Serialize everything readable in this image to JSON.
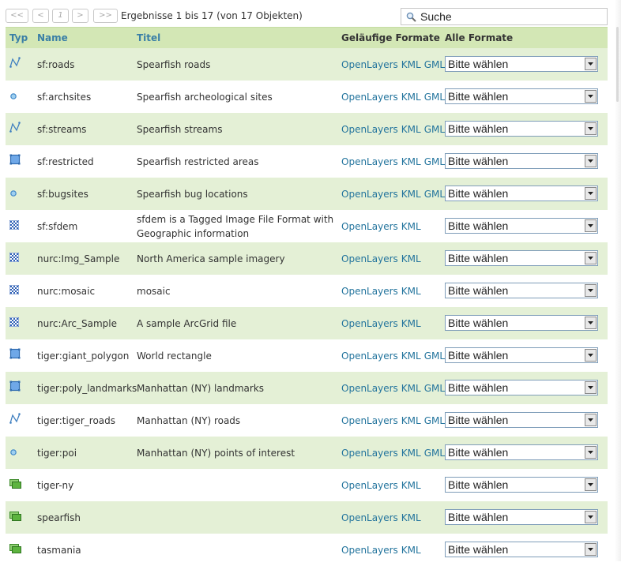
{
  "pagination": {
    "first": "<<",
    "prev": "<",
    "page": "1",
    "next": ">",
    "last": ">>",
    "results_text": "Ergebnisse 1 bis 17 (von 17 Objekten)"
  },
  "search": {
    "placeholder": "Suche",
    "value": ""
  },
  "columns": {
    "typ": "Typ",
    "name": "Name",
    "title": "Titel",
    "common_formats": "Geläufige Formate",
    "all_formats": "Alle Formate"
  },
  "colors": {
    "header_bg": "#d3e7b5",
    "row_alt_bg": "#e4f0d6",
    "link": "#23749d",
    "header_link": "#3a7fa6"
  },
  "rows": [
    {
      "icon": "line-icon",
      "name": "sf:roads",
      "title": "Spearfish roads",
      "formats": [
        "OpenLayers",
        "KML",
        "GML"
      ],
      "select": "Bitte wählen"
    },
    {
      "icon": "point-icon",
      "name": "sf:archsites",
      "title": "Spearfish archeological sites",
      "formats": [
        "OpenLayers",
        "KML",
        "GML"
      ],
      "select": "Bitte wählen"
    },
    {
      "icon": "line-icon",
      "name": "sf:streams",
      "title": "Spearfish streams",
      "formats": [
        "OpenLayers",
        "KML",
        "GML"
      ],
      "select": "Bitte wählen"
    },
    {
      "icon": "polygon-icon",
      "name": "sf:restricted",
      "title": "Spearfish restricted areas",
      "formats": [
        "OpenLayers",
        "KML",
        "GML"
      ],
      "select": "Bitte wählen"
    },
    {
      "icon": "point-icon",
      "name": "sf:bugsites",
      "title": "Spearfish bug locations",
      "formats": [
        "OpenLayers",
        "KML",
        "GML"
      ],
      "select": "Bitte wählen"
    },
    {
      "icon": "raster-icon",
      "name": "sf:sfdem",
      "title": "sfdem is a Tagged Image File Format with Geographic information",
      "formats": [
        "OpenLayers",
        "KML"
      ],
      "select": "Bitte wählen"
    },
    {
      "icon": "raster-icon",
      "name": "nurc:Img_Sample",
      "title": "North America sample imagery",
      "formats": [
        "OpenLayers",
        "KML"
      ],
      "select": "Bitte wählen"
    },
    {
      "icon": "raster-icon",
      "name": "nurc:mosaic",
      "title": "mosaic",
      "formats": [
        "OpenLayers",
        "KML"
      ],
      "select": "Bitte wählen"
    },
    {
      "icon": "raster-icon",
      "name": "nurc:Arc_Sample",
      "title": "A sample ArcGrid file",
      "formats": [
        "OpenLayers",
        "KML"
      ],
      "select": "Bitte wählen"
    },
    {
      "icon": "polygon-icon",
      "name": "tiger:giant_polygon",
      "title": "World rectangle",
      "formats": [
        "OpenLayers",
        "KML",
        "GML"
      ],
      "select": "Bitte wählen"
    },
    {
      "icon": "polygon-icon",
      "name": "tiger:poly_landmarks",
      "title": "Manhattan (NY) landmarks",
      "formats": [
        "OpenLayers",
        "KML",
        "GML"
      ],
      "select": "Bitte wählen"
    },
    {
      "icon": "line-icon",
      "name": "tiger:tiger_roads",
      "title": "Manhattan (NY) roads",
      "formats": [
        "OpenLayers",
        "KML",
        "GML"
      ],
      "select": "Bitte wählen"
    },
    {
      "icon": "point-icon",
      "name": "tiger:poi",
      "title": "Manhattan (NY) points of interest",
      "formats": [
        "OpenLayers",
        "KML",
        "GML"
      ],
      "select": "Bitte wählen"
    },
    {
      "icon": "layergroup-icon",
      "name": "tiger-ny",
      "title": "",
      "formats": [
        "OpenLayers",
        "KML"
      ],
      "select": "Bitte wählen"
    },
    {
      "icon": "layergroup-icon",
      "name": "spearfish",
      "title": "",
      "formats": [
        "OpenLayers",
        "KML"
      ],
      "select": "Bitte wählen"
    },
    {
      "icon": "layergroup-icon",
      "name": "tasmania",
      "title": "",
      "formats": [
        "OpenLayers",
        "KML"
      ],
      "select": "Bitte wählen"
    }
  ]
}
